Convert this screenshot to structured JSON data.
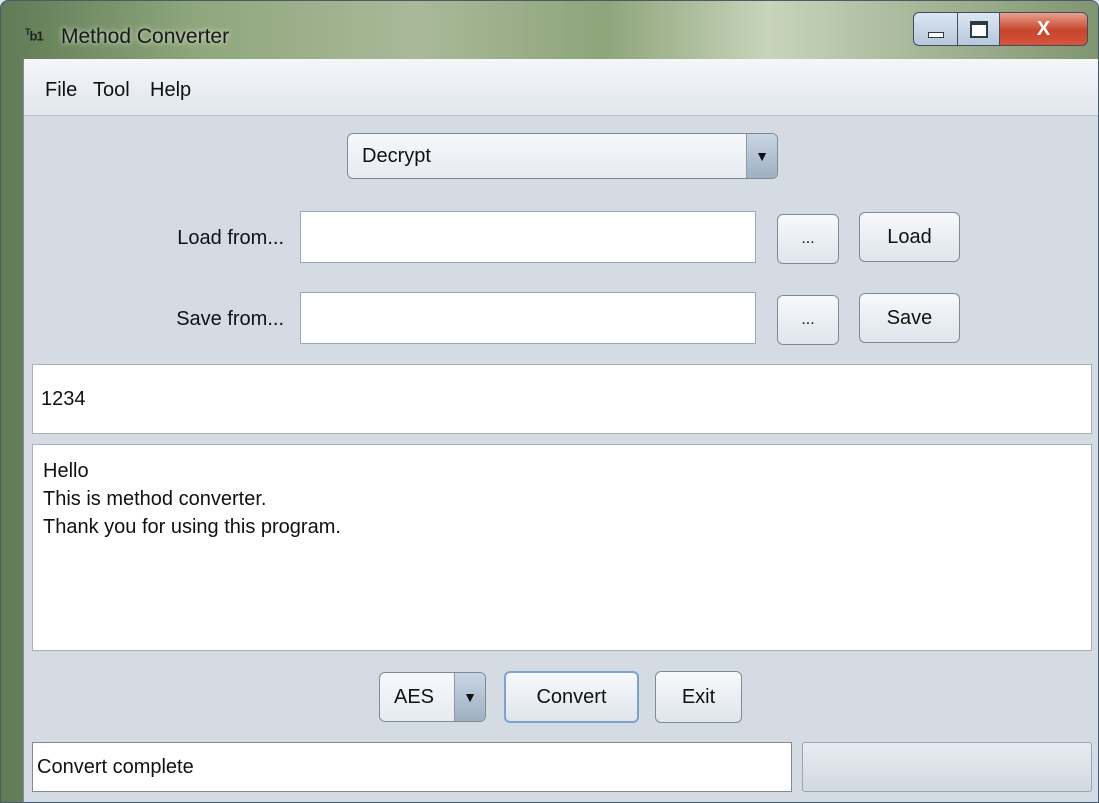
{
  "window": {
    "icon_text": "T",
    "icon_sub": "b1",
    "title": "Method Converter",
    "close_glyph": "X"
  },
  "menu": {
    "items": [
      {
        "label": "File"
      },
      {
        "label": "Tool"
      },
      {
        "label": "Help"
      }
    ]
  },
  "mode_select": {
    "value": "Decrypt",
    "arrow": "▼"
  },
  "load": {
    "label": "Load from...",
    "value": "",
    "browse_label": "...",
    "button_label": "Load"
  },
  "save": {
    "label": "Save from...",
    "value": "",
    "browse_label": "...",
    "button_label": "Save"
  },
  "key_field": {
    "value": "1234"
  },
  "content": {
    "lines": [
      "Hello",
      "This is method converter.",
      "Thank you for using this program."
    ]
  },
  "controls": {
    "algorithm": {
      "value": "AES",
      "arrow": "▼"
    },
    "convert_label": "Convert",
    "exit_label": "Exit"
  },
  "status": {
    "text": "Convert complete",
    "progress": 0
  }
}
